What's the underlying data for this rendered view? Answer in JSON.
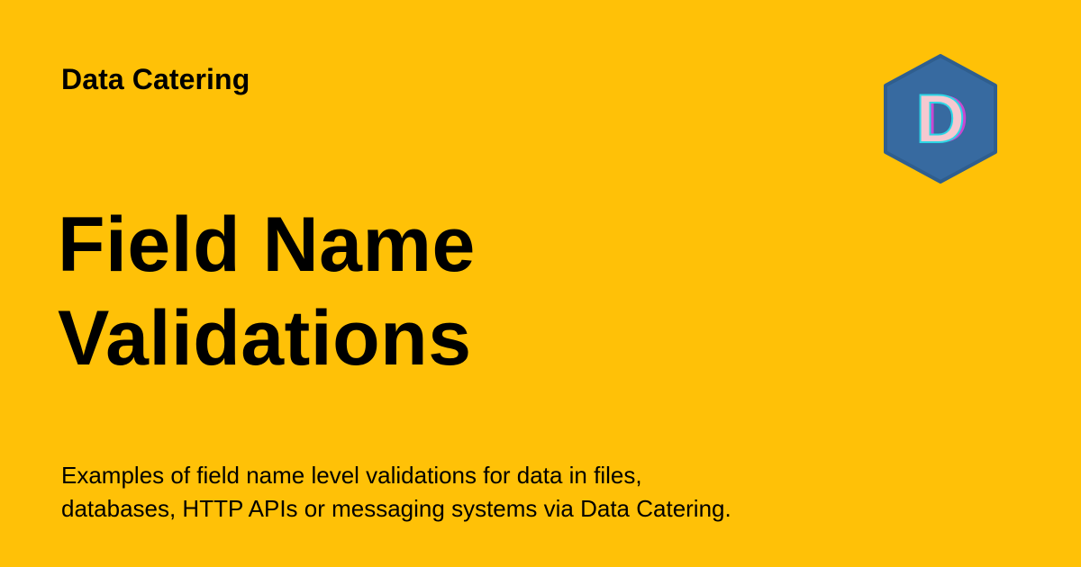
{
  "header": {
    "site_name": "Data Catering"
  },
  "main": {
    "title_lines": [
      "Field Name",
      "Validations"
    ],
    "description_lines": [
      "Examples of field name level validations for data in files,",
      "databases, HTTP APIs or messaging systems via Data Catering."
    ]
  },
  "logo": {
    "letter": "D",
    "icon": "hexagon-d-logo-icon"
  },
  "colors": {
    "background": "#FFC107",
    "text": "#000000",
    "logo_fill": "#376AA0",
    "logo_letter": "#F5C9D0"
  }
}
